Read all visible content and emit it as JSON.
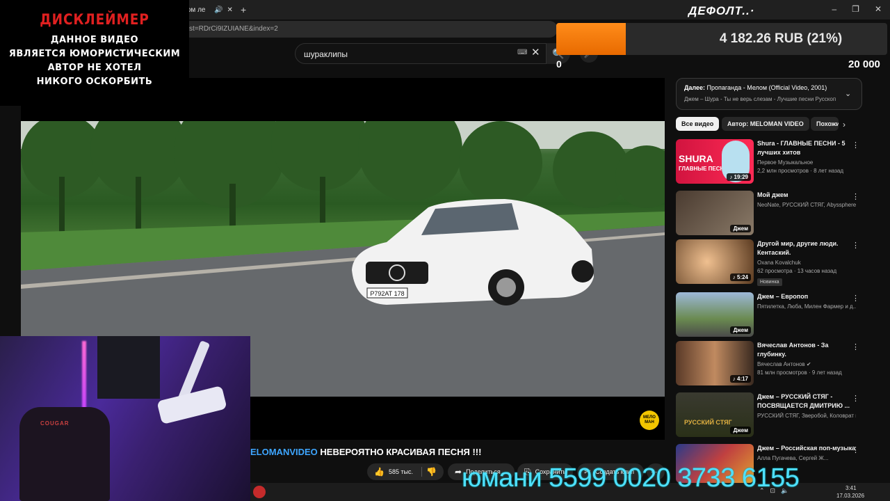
{
  "browser": {
    "tab_title": "мом ле",
    "url_fragment": "st=RDrCi9IZUIANE&index=2",
    "new_tab": "+",
    "win_min": "‒",
    "win_max": "❐",
    "win_close": "✕"
  },
  "search": {
    "query": "шураклипы"
  },
  "overlay": {
    "disclaimer_title": "ДИСКЛЕЙМЕР",
    "disclaimer_lines": [
      "ДАННОЕ ВИДЕО",
      "ЯВЛЯЕТСЯ ЮМОРИСТИЧЕСКИМ",
      "АВТОР НЕ ХОТЕЛ",
      "НИКОГО ОСКОРБИТЬ"
    ],
    "goal_name": "ДЕФОЛТ..·",
    "donation_text": "4 182.26 RUB (21%)",
    "donation_progress": 0.21,
    "counter_left": "0",
    "counter_right": "20 000",
    "payment_text": "юмани 5599 0020 3733 6155"
  },
  "video": {
    "plate": "Р792АТ 178",
    "channel_badge": "МЕЛО МАН",
    "title_channel": "ELOMANVIDEO",
    "title_text": "НЕВЕРОЯТНО КРАСИВАЯ ПЕСНЯ !!!",
    "actions": {
      "likes": "585 тыс.",
      "share": "Поделиться",
      "save": "Сохранить",
      "clip": "Создать клип"
    }
  },
  "up_next": {
    "label": "Далее:",
    "title": "Пропаганда - Мелом (Official Video, 2001)",
    "subtitle": "Джем – Шура - Ты не верь слезам - Лучшие песни Русскоп"
  },
  "chips": [
    "Все видео",
    "Автор: MELOMAN VIDEO",
    "Похожие"
  ],
  "recommendations": [
    {
      "title": "Shura - ГЛАВНЫЕ ПЕСНИ - 5 лучших хитов",
      "channel": "Первое Музыкальное",
      "meta": "2,2 млн просмотров · 8 лет назад",
      "duration": "♪ 19:29",
      "thumb_text": "SHURA",
      "thumb_sub": "ГЛАВНЫЕ ПЕСНИ"
    },
    {
      "title": "Мой джем",
      "channel": "NeoNate, РУССКИЙ СТЯГ, Abyssphere и...",
      "meta": "",
      "duration": "Джем"
    },
    {
      "title": "Другой мир, другие люди. Кентаский.",
      "channel": "Oxana Kovalchuk",
      "meta": "62 просмотра · 13 часов назад",
      "duration": "♪ 5:24",
      "badge": "Новинка"
    },
    {
      "title": "Джем – Европоп",
      "channel": "Пятилетка, Люба, Милен Фармер и д...",
      "meta": "",
      "duration": "Джем"
    },
    {
      "title": "Вячеслав Антонов - За глубинку.",
      "channel": "Вячеслав Антонов",
      "meta": "81 млн просмотров · 9 лет назад",
      "duration": "♪ 4:17"
    },
    {
      "title": "Джем – РУССКИЙ СТЯГ - ПОСВЯЩАЕТСЯ ДМИТРИЮ ...",
      "channel": "РУССКИЙ СТЯГ, Зверобой, Коловрат и...",
      "meta": "",
      "duration": "Джем",
      "thumb_text": "РУССКИЙ СТЯГ"
    },
    {
      "title": "Джем – Российская поп-музыка",
      "channel": "Алла Пугачева, Сергей Ж...",
      "meta": "",
      "duration": ""
    }
  ],
  "webcam": {
    "chair_brand": "COUGAR"
  },
  "taskbar": {
    "time": "3:41",
    "date": "17.03.2026"
  },
  "colors": {
    "accent": "#3ea6ff",
    "donation": "#ff8c1a",
    "disclaimer": "#e02020",
    "payment": "#4fe0ff"
  }
}
